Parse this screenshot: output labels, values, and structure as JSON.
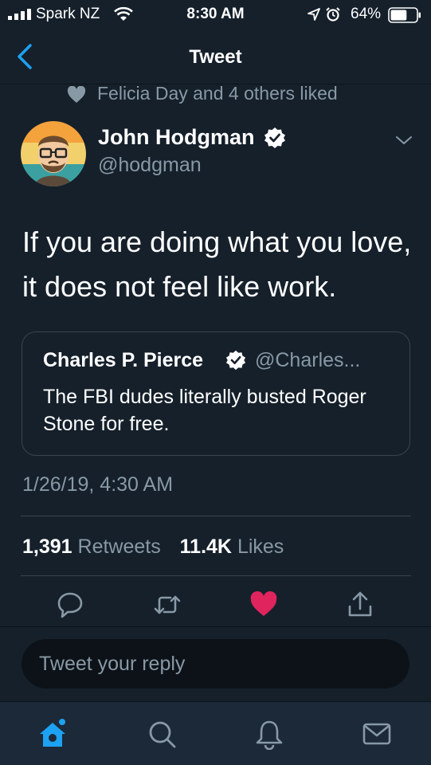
{
  "status": {
    "carrier": "Spark NZ",
    "time": "8:30 AM",
    "battery": "64%",
    "battery_level": 0.64
  },
  "nav": {
    "title": "Tweet"
  },
  "social_context": {
    "text": "Felicia Day and 4 others liked"
  },
  "author": {
    "name": "John Hodgman",
    "handle": "@hodgman"
  },
  "tweet": {
    "text": "If you are doing what you love, it does not feel like work."
  },
  "quoted": {
    "name": "Charles P. Pierce",
    "handle": "@Charles...",
    "text": "The FBI dudes literally busted Roger Stone for free."
  },
  "timestamp": "1/26/19, 4:30 AM",
  "stats": {
    "retweets_count": "1,391",
    "retweets_label": "Retweets",
    "likes_count": "11.4K",
    "likes_label": "Likes"
  },
  "actions": {
    "icons": [
      "reply-icon",
      "retweet-icon",
      "like-icon",
      "share-icon"
    ],
    "liked_color": "#e0245e"
  },
  "reply": {
    "placeholder": "Tweet your reply"
  },
  "tabbar": {
    "icons": [
      "home-icon",
      "search-icon",
      "notifications-icon",
      "messages-icon"
    ],
    "active_color": "#1da1f2"
  },
  "colors": {
    "background": "#15202b",
    "secondary_text": "#8899a6",
    "accent": "#1da1f2"
  }
}
